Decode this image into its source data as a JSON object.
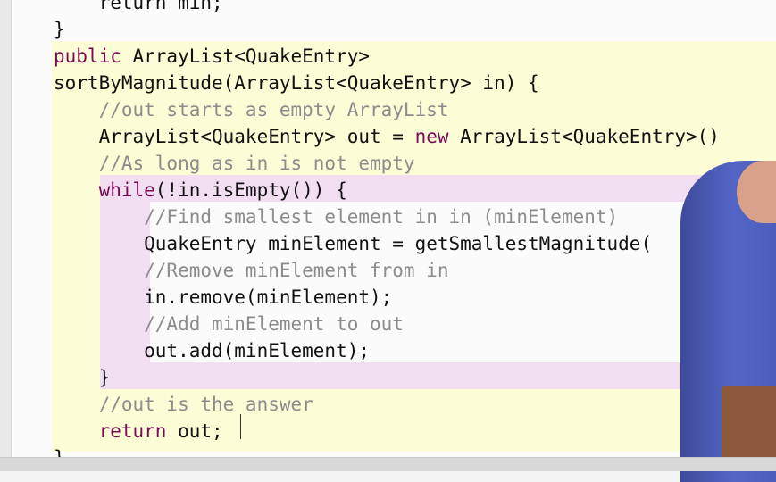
{
  "code_lines": [
    {
      "kind": "plain",
      "text": "    return min;"
    },
    {
      "kind": "plain",
      "text": "}"
    },
    {
      "kind": "kw_plain",
      "kw": "public",
      "text": " ArrayList<QuakeEntry>"
    },
    {
      "kind": "plain",
      "text": "sortByMagnitude(ArrayList<QuakeEntry> in) {"
    },
    {
      "kind": "comment",
      "text": "    //out starts as empty ArrayList"
    },
    {
      "kind": "plain_kw_plain",
      "a": "    ArrayList<QuakeEntry> out = ",
      "kw": "new",
      "b": " ArrayList<QuakeEntry>()"
    },
    {
      "kind": "comment",
      "text": "    //As long as in is not empty"
    },
    {
      "kind": "kw_plain",
      "kw": "    while",
      "text": "(!in.isEmpty()) {"
    },
    {
      "kind": "comment",
      "text": "        //Find smallest element in in (minElement)"
    },
    {
      "kind": "plain",
      "text": "        QuakeEntry minElement = getSmallestMagnitude("
    },
    {
      "kind": "comment",
      "text": "        //Remove minElement from in"
    },
    {
      "kind": "plain",
      "text": "        in.remove(minElement);"
    },
    {
      "kind": "comment",
      "text": "        //Add minElement to out"
    },
    {
      "kind": "plain",
      "text": "        out.add(minElement);"
    },
    {
      "kind": "plain",
      "text": "    }"
    },
    {
      "kind": "comment",
      "text": "    //out is the answer"
    },
    {
      "kind": "kw_plain",
      "kw": "    return",
      "text": " out;"
    },
    {
      "kind": "plain",
      "text": "}"
    }
  ]
}
